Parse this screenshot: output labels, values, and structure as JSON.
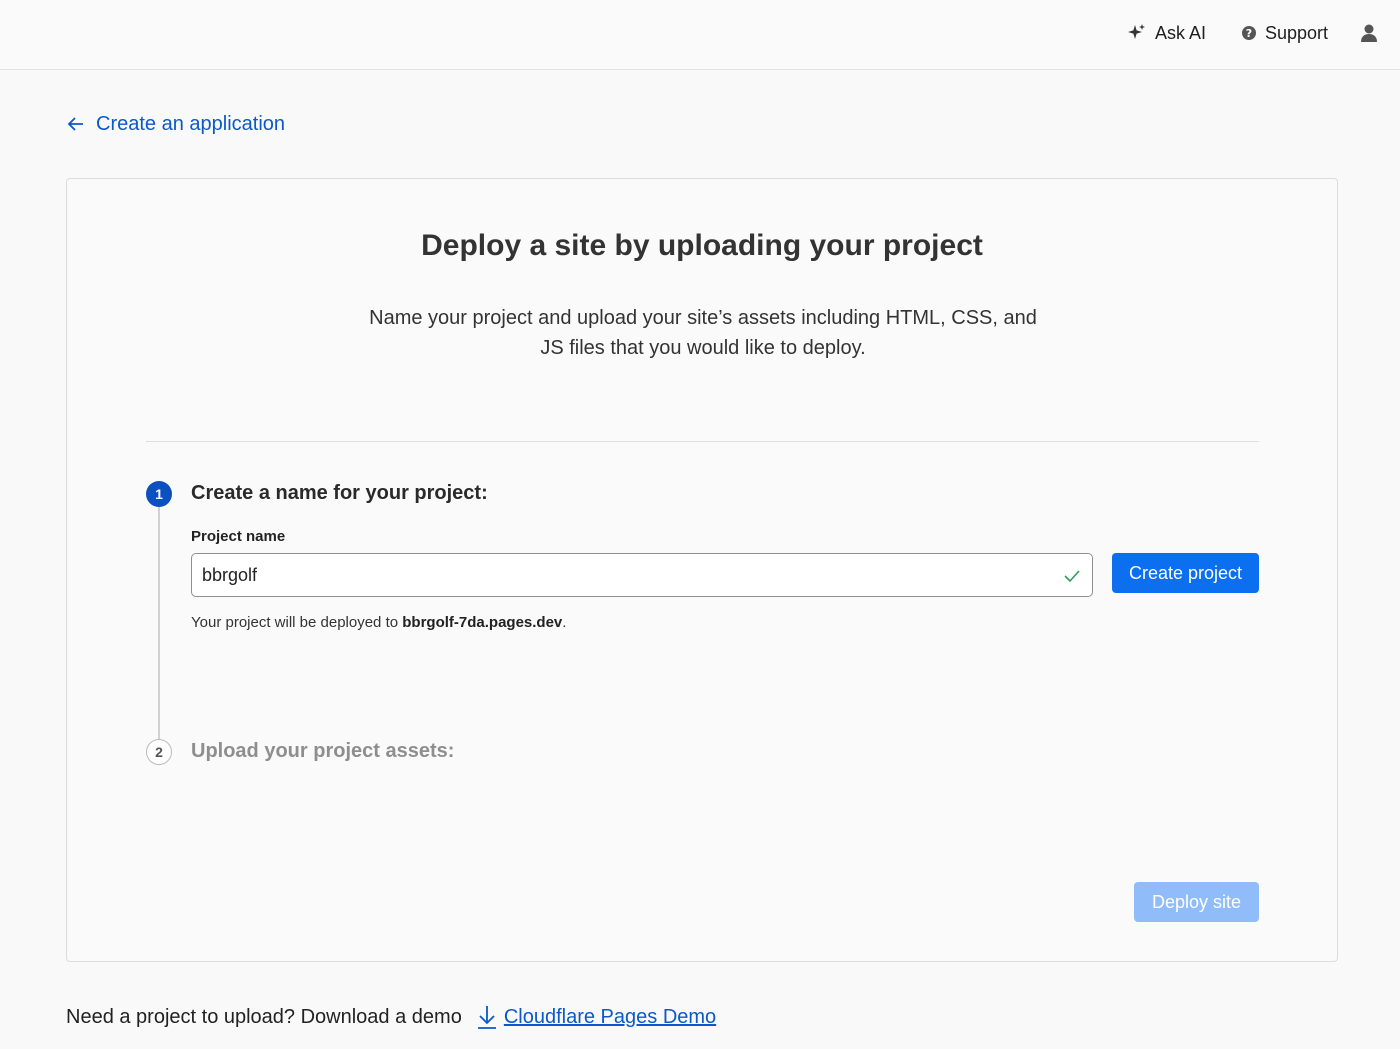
{
  "header": {
    "ask_ai": "Ask AI",
    "support": "Support"
  },
  "breadcrumb": {
    "back_label": "Create an application"
  },
  "card": {
    "title": "Deploy a site by uploading your project",
    "description": "Name your project and upload your site’s assets including HTML, CSS, and JS files that you would like to deploy.",
    "step1": {
      "number": "1",
      "title": "Create a name for your project:",
      "field_label": "Project name",
      "input_value": "bbrgolf",
      "button_label": "Create project",
      "note_prefix": "Your project will be deployed to ",
      "note_domain": "bbrgolf-7da.pages.dev",
      "note_suffix": "."
    },
    "step2": {
      "number": "2",
      "title": "Upload your project assets:"
    },
    "deploy_button": "Deploy site"
  },
  "footer": {
    "prompt": "Need a project to upload? Download a demo",
    "demo_link": "Cloudflare Pages Demo"
  },
  "colors": {
    "accent": "#0b6ff0",
    "link": "#0b59c9",
    "step_active": "#0b4fc0",
    "disabled": "#90bdfa",
    "check": "#2e9e5b"
  }
}
